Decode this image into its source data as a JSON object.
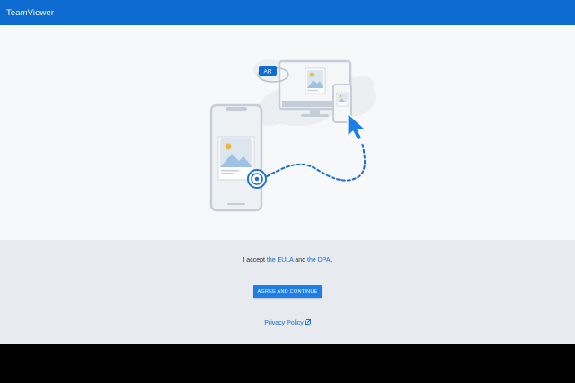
{
  "header": {
    "title": "TeamViewer"
  },
  "illustration": {
    "ar_badge": "AR",
    "colors": {
      "accent": "#1d7ee6",
      "device_outline": "#c5ced8",
      "device_fill": "#eef1f4",
      "photo_bg": "#dde6ee",
      "sun": "#f2b53c",
      "mountain": "#9fc2e3"
    }
  },
  "consent": {
    "prefix": "I accept ",
    "eula_link": "the EULA",
    "middle": " and ",
    "dpa_link": "the DPA",
    "suffix": "."
  },
  "actions": {
    "agree_label": "AGREE AND CONTINUE"
  },
  "links": {
    "privacy_label": "Privacy Policy"
  },
  "colors": {
    "brand": "#0e6bd0",
    "button": "#1d7ee6",
    "footer_bg": "#e7ebef",
    "hero_bg": "#f7f8f9"
  }
}
